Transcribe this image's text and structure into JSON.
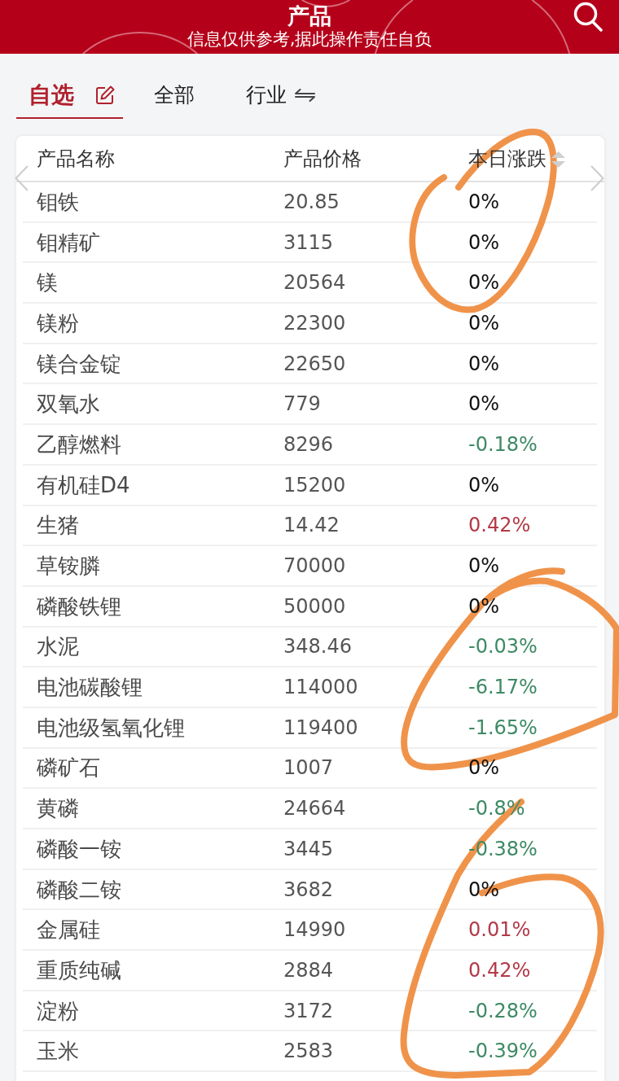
{
  "header": {
    "title": "产品",
    "subtitle": "信息仅供参考,据此操作责任自负"
  },
  "tabs": [
    {
      "label": "自选",
      "selected": true,
      "kind": "edit"
    },
    {
      "label": "全部",
      "selected": false,
      "kind": "plain"
    },
    {
      "label": "行业",
      "selected": false,
      "kind": "swap"
    }
  ],
  "table": {
    "columns": [
      {
        "label": "产品名称",
        "sortable": false
      },
      {
        "label": "产品价格",
        "sortable": false
      },
      {
        "label": "本日涨跌",
        "sortable": true
      }
    ],
    "rows": [
      {
        "name": "钼铁",
        "price": "20.85",
        "change": "0%",
        "color": "#111111"
      },
      {
        "name": "钼精矿",
        "price": "3115",
        "change": "0%",
        "color": "#111111"
      },
      {
        "name": "镁",
        "price": "20564",
        "change": "0%",
        "color": "#111111"
      },
      {
        "name": "镁粉",
        "price": "22300",
        "change": "0%",
        "color": "#111111"
      },
      {
        "name": "镁合金锭",
        "price": "22650",
        "change": "0%",
        "color": "#111111"
      },
      {
        "name": "双氧水",
        "price": "779",
        "change": "0%",
        "color": "#111111"
      },
      {
        "name": "乙醇燃料",
        "price": "8296",
        "change": "-0.18%",
        "color": "#3e8a65"
      },
      {
        "name": "有机硅D4",
        "price": "15200",
        "change": "0%",
        "color": "#111111"
      },
      {
        "name": "生猪",
        "price": "14.42",
        "change": "0.42%",
        "color": "#b23a48"
      },
      {
        "name": "草铵膦",
        "price": "70000",
        "change": "0%",
        "color": "#111111"
      },
      {
        "name": "磷酸铁锂",
        "price": "50000",
        "change": "0%",
        "color": "#111111"
      },
      {
        "name": "水泥",
        "price": "348.46",
        "change": "-0.03%",
        "color": "#3e8a65"
      },
      {
        "name": "电池碳酸锂",
        "price": "114000",
        "change": "-6.17%",
        "color": "#3e8a65"
      },
      {
        "name": "电池级氢氧化锂",
        "price": "119400",
        "change": "-1.65%",
        "color": "#3e8a65"
      },
      {
        "name": "磷矿石",
        "price": "1007",
        "change": "0%",
        "color": "#111111"
      },
      {
        "name": "黄磷",
        "price": "24664",
        "change": "-0.8%",
        "color": "#3e8a65"
      },
      {
        "name": "磷酸一铵",
        "price": "3445",
        "change": "-0.38%",
        "color": "#3e8a65"
      },
      {
        "name": "磷酸二铵",
        "price": "3682",
        "change": "0%",
        "color": "#111111"
      },
      {
        "name": "金属硅",
        "price": "14990",
        "change": "0.01%",
        "color": "#b23a48"
      },
      {
        "name": "重质纯碱",
        "price": "2884",
        "change": "0.42%",
        "color": "#b23a48"
      },
      {
        "name": "淀粉",
        "price": "3172",
        "change": "-0.28%",
        "color": "#3e8a65"
      },
      {
        "name": "玉米",
        "price": "2583",
        "change": "-0.39%",
        "color": "#3e8a65"
      }
    ]
  },
  "annotations": [
    {
      "kind": "loop"
    },
    {
      "kind": "loop"
    },
    {
      "kind": "loop"
    }
  ]
}
